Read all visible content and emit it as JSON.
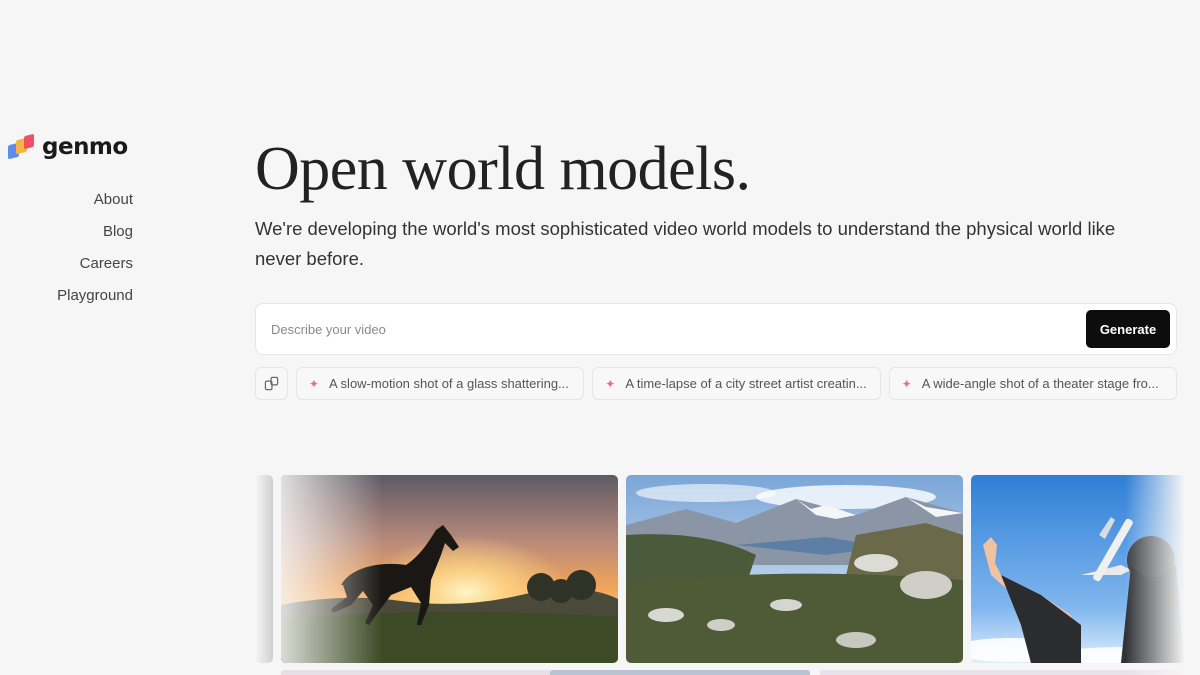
{
  "brand": {
    "name": "genmo"
  },
  "nav": {
    "items": [
      {
        "label": "About"
      },
      {
        "label": "Blog"
      },
      {
        "label": "Careers"
      },
      {
        "label": "Playground"
      }
    ]
  },
  "hero": {
    "title": "Open world models.",
    "subtitle": "We're developing the world's most sophisticated video world models to understand the physical world like never before."
  },
  "prompt": {
    "placeholder": "Describe your video",
    "value": "",
    "generate_label": "Generate"
  },
  "suggestions": {
    "items": [
      {
        "label": "A slow-motion shot of a glass shattering..."
      },
      {
        "label": "A time-lapse of a city street artist creatin..."
      },
      {
        "label": "A wide-angle shot of a theater stage fro..."
      }
    ]
  },
  "gallery": {
    "items": [
      {
        "icon": "horse-silhouette-sunset-image"
      },
      {
        "icon": "mountain-fjord-landscape-image"
      },
      {
        "icon": "skydiver-airplane-image"
      }
    ]
  },
  "colors": {
    "background": "#f6f6f6",
    "button": "#0d0d0d",
    "sparkle": "#ea6b8a"
  }
}
